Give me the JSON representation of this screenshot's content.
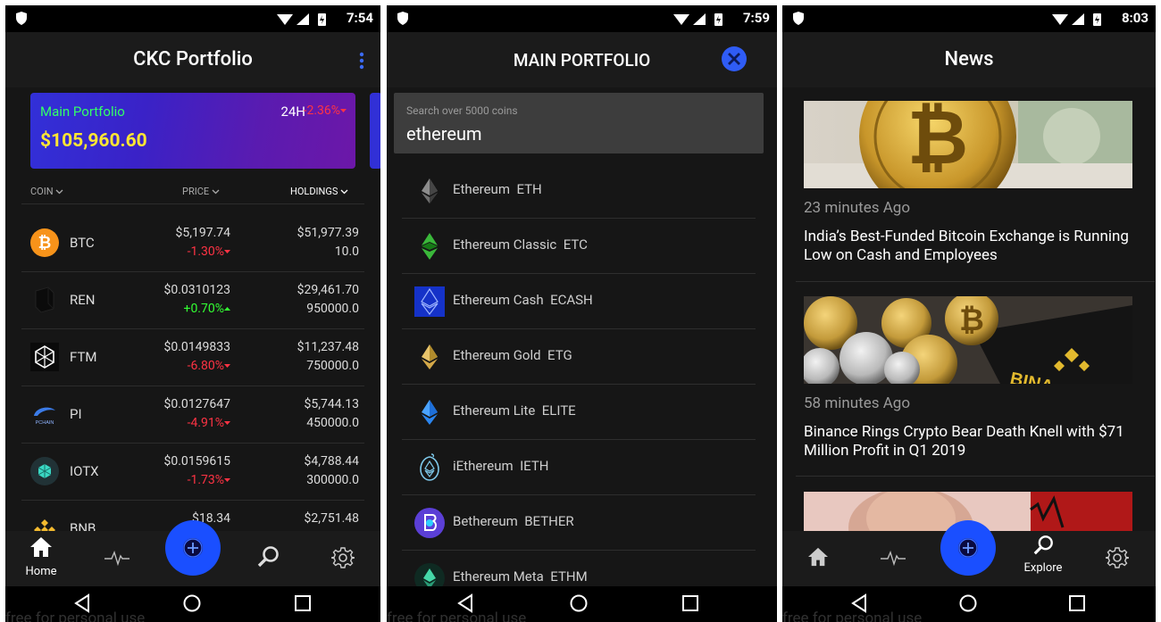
{
  "status_bar": {
    "times": [
      "7:54",
      "7:59",
      "8:03"
    ]
  },
  "watermark": "free for personal use",
  "portfolio": {
    "title": "CKC Portfolio",
    "card": {
      "name": "Main Portfolio",
      "value": "$105,960.60",
      "period": "24H",
      "change": "-2.36%"
    },
    "columns": {
      "coin": "COIN",
      "price": "PRICE",
      "holdings": "HOLDINGS"
    },
    "coins": [
      {
        "symbol": "BTC",
        "icon": "bitcoin-icon",
        "price": "$5,197.74",
        "change": "-1.30%",
        "value": "$51,977.39",
        "quantity": "10.0"
      },
      {
        "symbol": "REN",
        "icon": "ren-icon",
        "price": "$0.0310123",
        "change": "+0.70%",
        "value": "$29,461.70",
        "quantity": "950000.0"
      },
      {
        "symbol": "FTM",
        "icon": "fantom-icon",
        "price": "$0.0149833",
        "change": "-6.80%",
        "value": "$11,237.48",
        "quantity": "750000.0"
      },
      {
        "symbol": "PI",
        "icon": "pchain-icon",
        "icon_text": "PCHAIN",
        "price": "$0.0127647",
        "change": "-4.91%",
        "value": "$5,744.13",
        "quantity": "450000.0"
      },
      {
        "symbol": "IOTX",
        "icon": "iotex-icon",
        "price": "$0.0159615",
        "change": "-1.73%",
        "value": "$4,788.44",
        "quantity": "300000.0"
      },
      {
        "symbol": "BNB",
        "icon": "binance-icon",
        "price": "$18.34",
        "change": "",
        "value": "$2,751.48",
        "quantity": ""
      }
    ],
    "bottom_nav": {
      "home": "Home"
    }
  },
  "search": {
    "title": "MAIN PORTFOLIO",
    "placeholder": "Search over 5000 coins",
    "query": "ethereum",
    "results": [
      {
        "name": "Ethereum",
        "symbol": "ETH",
        "icon": "ethereum-icon"
      },
      {
        "name": "Ethereum Classic",
        "symbol": "ETC",
        "icon": "ethereum-classic-icon"
      },
      {
        "name": "Ethereum Cash",
        "symbol": "ECASH",
        "icon": "ethereum-cash-icon"
      },
      {
        "name": "Ethereum Gold",
        "symbol": "ETG",
        "icon": "ethereum-gold-icon"
      },
      {
        "name": "Ethereum Lite",
        "symbol": "ELITE",
        "icon": "ethereum-lite-icon"
      },
      {
        "name": "iEthereum",
        "symbol": "IETH",
        "icon": "iethereum-icon"
      },
      {
        "name": "Bethereum",
        "symbol": "BETHER",
        "icon": "bethereum-icon"
      },
      {
        "name": "Ethereum Meta",
        "symbol": "ETHM",
        "icon": "ethereum-meta-icon"
      }
    ]
  },
  "news": {
    "title": "News",
    "items": [
      {
        "time": "23 minutes Ago",
        "headline": "India’s Best-Funded Bitcoin Exchange is Running Low on Cash and Employees"
      },
      {
        "time": "58 minutes Ago",
        "headline": "Binance Rings Crypto Bear Death Knell with $71 Million Profit in Q1 2019"
      }
    ],
    "image_text": "BINA",
    "bottom_nav": {
      "explore": "Explore"
    }
  }
}
